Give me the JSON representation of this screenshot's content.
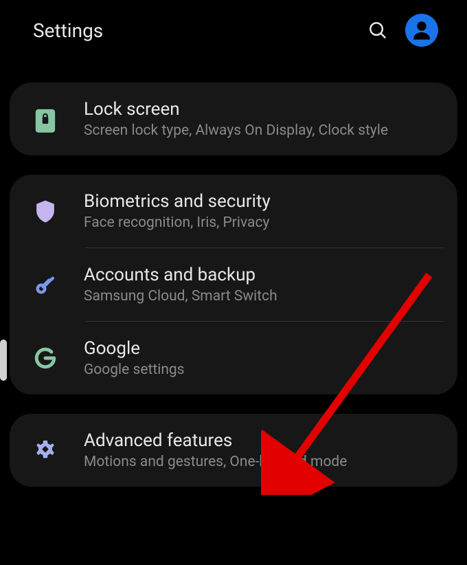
{
  "header": {
    "title": "Settings"
  },
  "colors": {
    "accent_blue": "#1a73e8",
    "icon_green": "#86c7a2",
    "icon_purple": "#c5b4ee",
    "icon_blue": "#7d96e8",
    "icon_lightblue": "#a5afec"
  },
  "groups": [
    {
      "items": [
        {
          "icon": "lock-icon",
          "title": "Lock screen",
          "subtitle": "Screen lock type, Always On Display, Clock style"
        }
      ]
    },
    {
      "items": [
        {
          "icon": "shield-icon",
          "title": "Biometrics and security",
          "subtitle": "Face recognition, Iris, Privacy"
        },
        {
          "icon": "key-icon",
          "title": "Accounts and backup",
          "subtitle": "Samsung Cloud, Smart Switch"
        },
        {
          "icon": "google-icon",
          "title": "Google",
          "subtitle": "Google settings"
        }
      ]
    },
    {
      "items": [
        {
          "icon": "gear-icon",
          "title": "Advanced features",
          "subtitle": "Motions and gestures, One-handed mode"
        }
      ]
    }
  ]
}
